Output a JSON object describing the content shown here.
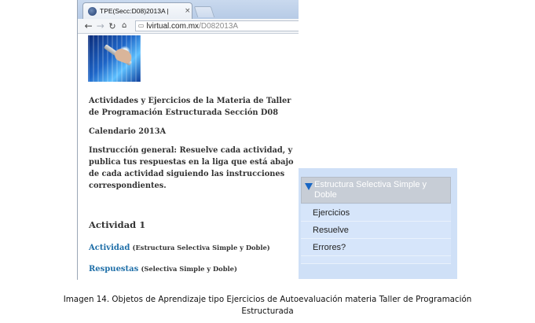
{
  "browser": {
    "tab_title": "TPE(Secc:D08)2013A |",
    "tab_close": "×",
    "url_host": "lvirtual.com.mx",
    "url_path": "/D082013A"
  },
  "page": {
    "title": "Actividades y Ejercicios de la Materia de Taller de Programación Estructurada Sección D08",
    "calendar": "Calendario 2013A",
    "instruction": "Instrucción general: Resuelve cada actividad, y publica tus respuestas en la liga que está abajo de cada actividad siguiendo las instrucciones correspondientes.",
    "activity_heading": "Actividad 1",
    "activity_link": "Actividad",
    "activity_note": "(Estructura Selectiva Simple y Doble)",
    "answers_link": "Respuestas",
    "answers_note": "(Selectiva Simple y Doble)"
  },
  "panel": {
    "header": "Estructura Selectiva Simple y Doble",
    "items": [
      "Ejercicios",
      "Resuelve",
      "Errores?"
    ]
  },
  "caption": {
    "line1": "Imagen 14. Objetos de Aprendizaje tipo Ejercicios de Autoevaluación materia Taller de Programación",
    "line2": "Estructurada"
  },
  "icons": {
    "back": "arrow-left-icon",
    "forward": "arrow-right-icon",
    "reload": "reload-icon",
    "home": "home-icon",
    "page": "page-icon",
    "favicon": "globe-favicon-icon",
    "expand": "triangle-down-icon"
  }
}
